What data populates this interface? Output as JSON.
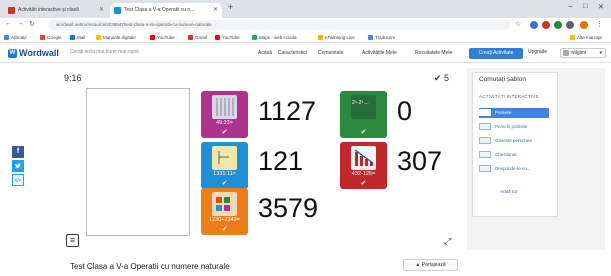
{
  "browser": {
    "tabs": [
      {
        "title": "Activitâti interactive și clasă",
        "active": false
      },
      {
        "title": "Test Clasa a V-a Operatii cu n...",
        "active": true
      }
    ],
    "new_tab": "+",
    "window_controls": {
      "minimize": "−",
      "maximize": "□",
      "close": "✕"
    },
    "url": "wordwall.net/ro/resource/2036947/test-clasa-a-va-operatii-cu-numere-naturale",
    "bookmarks": [
      "Aplicații",
      "Google",
      "Mail",
      "Manuale digitale",
      "YouTube",
      "Gmail",
      "YouTube",
      "Maps - web scuola",
      "eTwinning Live",
      "Traducere"
    ],
    "bookmarks_right": "Alte marcaje"
  },
  "header": {
    "logo": "Wordwall",
    "search_placeholder": "Creați lecții mai bune mai rapid",
    "nav": [
      "Acasă",
      "Caracteristici",
      "Comunitate",
      "Activitățile Mele",
      "Rezultatele Mele"
    ],
    "create_button": "Creați Activitate",
    "upgrade_button": "Upgrade",
    "user_button": "wilgimi"
  },
  "game": {
    "timer": "9:16",
    "score": "✔ 5",
    "tiles": [
      {
        "label": "49:23=",
        "color": "#b0328f",
        "answer": "1127"
      },
      {
        "label": "2⁴·2³ ...",
        "color": "#2b8a3e",
        "answer": "0"
      },
      {
        "label": "1331:11=",
        "color": "#1f8fd6",
        "answer": "121"
      },
      {
        "label": "432-125=",
        "color": "#c0282d",
        "answer": "307"
      },
      {
        "label": "1230+2349=",
        "color": "#ec7d1a",
        "answer": "3579"
      }
    ],
    "check": "✔",
    "menu_icon": "menu-icon",
    "fullscreen_icon": "fullscreen-icon"
  },
  "panel": {
    "title": "Comutați șablon",
    "subtitle": "ACTIVITĂȚI INTERACTIVE",
    "options": [
      "Potrivire",
      "Perechi potrivite",
      "Gaseste perechea",
      "Chestionar",
      "Desprinde-te cu..."
    ],
    "selected_index": 0,
    "more": "Arată tot"
  },
  "social": [
    "f",
    "t",
    "</>"
  ],
  "footer": {
    "activity_title": "Test Clasa a V-a Operatii cu numere naturale",
    "share_button": "Partajează"
  }
}
